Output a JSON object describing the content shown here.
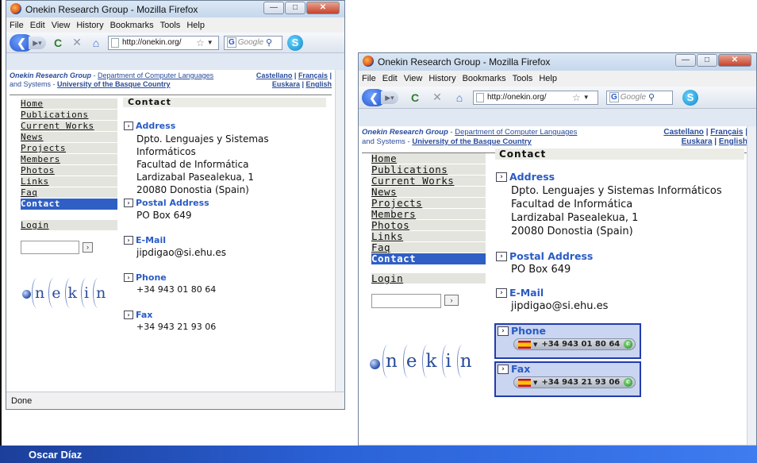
{
  "footer": {
    "author": "Oscar Díaz"
  },
  "browser": {
    "title": "Onekin Research Group - Mozilla Firefox",
    "menu": [
      "File",
      "Edit",
      "View",
      "History",
      "Bookmarks",
      "Tools",
      "Help"
    ],
    "url": "http://onekin.org/",
    "search_placeholder": "Google",
    "status": "Done"
  },
  "header": {
    "group": "Onekin Research Group",
    "dept": "Department of Computer Languages",
    "and_systems": "and Systems - ",
    "university": "University of the Basque Country",
    "languages": {
      "castellano": "Castellano",
      "francais": "Français",
      "euskara": "Euskara",
      "english": "English",
      "sep": " | "
    }
  },
  "nav": {
    "items": [
      "Home",
      "Publications",
      "Current Works",
      "News",
      "Projects",
      "Members",
      "Photos",
      "Links",
      "Faq",
      "Contact"
    ],
    "active": "Contact",
    "login": "Login"
  },
  "logo": {
    "letters": [
      "n",
      "e",
      "k",
      "i",
      "n"
    ]
  },
  "content": {
    "heading": "Contact",
    "address": {
      "title": "Address",
      "lines": [
        "Dpto. Lenguajes y Sistemas Informáticos",
        "Facultad de Informática",
        "Lardizabal Pasealekua, 1",
        "20080 Donostia (Spain)"
      ]
    },
    "postal": {
      "title": "Postal Address",
      "line": "PO Box 649"
    },
    "email": {
      "title": "E-Mail",
      "line": "jipdigao@si.ehu.es"
    },
    "phone": {
      "title": "Phone",
      "line": "+34 943 01 80 64"
    },
    "fax": {
      "title": "Fax",
      "line": "+34 943 21 93 06"
    }
  },
  "colors": {
    "link": "#2a5bc4",
    "active_nav": "#2f5fc4",
    "highlight_border": "#233cad",
    "footer": "#2b62d8"
  }
}
